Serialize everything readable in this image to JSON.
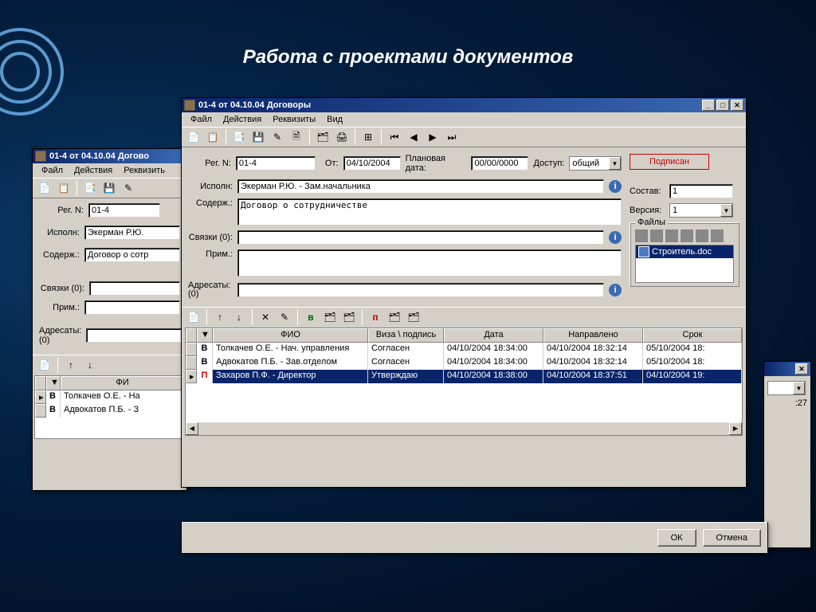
{
  "slide": {
    "title": "Работа с проектами документов"
  },
  "win_back": {
    "title": "01-4 от 04.10.04 Догово",
    "menu": [
      "Файл",
      "Действия",
      "Реквизить"
    ],
    "reg_label": "Рег. N:",
    "reg_value": "01-4",
    "executor_label": "Исполн:",
    "executor_value": "Экерман Р.Ю.",
    "content_label": "Содерж.:",
    "content_value": "Договор о сотр",
    "links_label": "Связки (0):",
    "note_label": "Прим.:",
    "addressees_label": "Адресаты: (0)",
    "grid_header": "ФИ",
    "rows": [
      {
        "type": "В",
        "name": "Толкачев О.Е. - На"
      },
      {
        "type": "В",
        "name": "Адвокатов П.Б. - З"
      }
    ]
  },
  "win_front": {
    "title": "01-4 от 04.10.04 Договоры",
    "menu": [
      "Файл",
      "Действия",
      "Реквизиты",
      "Вид"
    ],
    "reg_label": "Рег. N:",
    "reg_value": "01-4",
    "date_from_label": "От:",
    "date_from_value": "04/10/2004",
    "plan_date_label": "Плановая дата:",
    "plan_date_value": "00/00/0000",
    "access_label": "Доступ:",
    "access_value": "общий",
    "status": "Подписан",
    "executor_label": "Исполн:",
    "executor_value": "Экерман Р.Ю. - Зам.начальника",
    "content_label": "Содерж.:",
    "content_value": "Договор о сотрудничестве",
    "links_label": "Связки (0):",
    "note_label": "Прим.:",
    "addressees_label": "Адресаты: (0)",
    "composition_label": "Состав:",
    "composition_value": "1",
    "version_label": "Версия:",
    "version_value": "1",
    "files_label": "Файлы",
    "file_name": "Строитель.doc",
    "grid_headers": [
      "",
      "",
      "ФИО",
      "Виза \\ подпись",
      "Дата",
      "Направлено",
      "Срок"
    ],
    "grid_rows": [
      {
        "type": "В",
        "name": "Толкачев О.Е. - Нач. управления",
        "visa": "Согласен",
        "date": "04/10/2004 18:34:00",
        "sent": "04/10/2004 18:32:14",
        "due": "05/10/2004 18:"
      },
      {
        "type": "В",
        "name": "Адвокатов П.Б. - Зав.отделом",
        "visa": "Согласен",
        "date": "04/10/2004 18:34:00",
        "sent": "04/10/2004 18:32:14",
        "due": "05/10/2004 18:"
      },
      {
        "type": "П",
        "name": "Захаров П.Ф. - Директор",
        "visa": "Утверждаю",
        "date": "04/10/2004 18:38:00",
        "sent": "04/10/2004 18:37:51",
        "due": "04/10/2004 19:"
      }
    ]
  },
  "dialog": {
    "ok": "ОК",
    "cancel": "Отмена",
    "dropdown_text": "",
    "number": ":27"
  }
}
